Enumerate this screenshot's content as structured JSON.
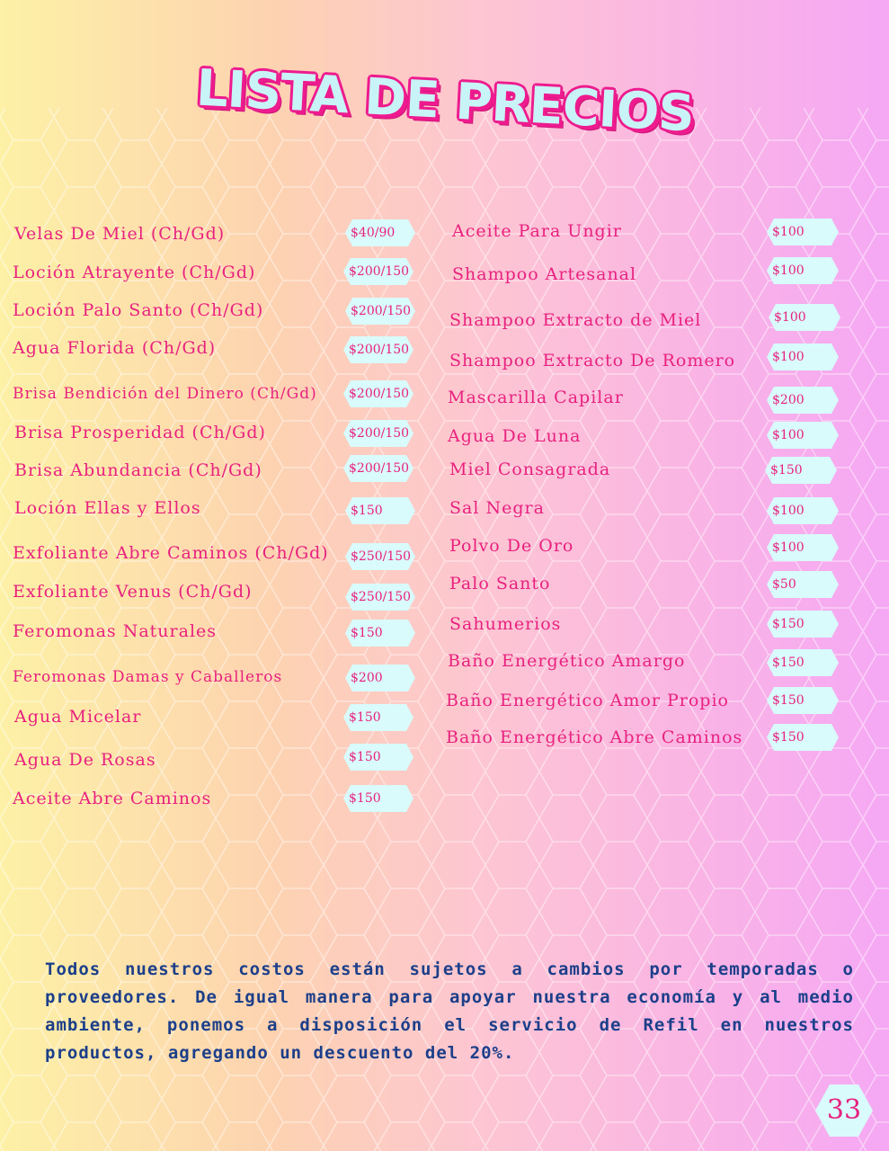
{
  "title": "LISTA DE PRECIOS",
  "left_items": [
    {
      "name": "Velas De Miel (Ch/Gd)",
      "price": "$40/90"
    },
    {
      "name": "Loción Atrayente (Ch/Gd)",
      "price": "$200/150"
    },
    {
      "name": "Loción Palo Santo (Ch/Gd)",
      "price": "$200/150"
    },
    {
      "name": "Agua Florida (Ch/Gd)",
      "price": "$200/150"
    },
    {
      "name": "Brisa Bendición del Dinero (Ch/Gd)",
      "price": "$200/150"
    },
    {
      "name": "Brisa Prosperidad (Ch/Gd)",
      "price": "$200/150"
    },
    {
      "name": "Brisa Abundancia (Ch/Gd)",
      "price": "$200/150"
    },
    {
      "name": "Loción Ellas y Ellos",
      "price": "$150"
    },
    {
      "name": "Exfoliante Abre Caminos (Ch/Gd)",
      "price": "$250/150"
    },
    {
      "name": "Exfoliante Venus (Ch/Gd)",
      "price": "$250/150"
    },
    {
      "name": "Feromonas Naturales",
      "price": "$150"
    },
    {
      "name": "Feromonas Damas y Caballeros",
      "price": "$200"
    },
    {
      "name": "Agua Micelar",
      "price": "$150"
    },
    {
      "name": "Agua De Rosas",
      "price": "$150"
    },
    {
      "name": "Aceite Abre Caminos",
      "price": "$150"
    }
  ],
  "right_items": [
    {
      "name": "Aceite Para Ungir",
      "price": "$100"
    },
    {
      "name": "Shampoo Artesanal",
      "price": "$100"
    },
    {
      "name": "Shampoo Extracto de Miel",
      "price": "$100"
    },
    {
      "name": "Shampoo Extracto De Romero",
      "price": "$100"
    },
    {
      "name": "Mascarilla Capilar",
      "price": "$200"
    },
    {
      "name": "Agua De Luna",
      "price": "$100"
    },
    {
      "name": "Miel Consagrada",
      "price": "$150"
    },
    {
      "name": "Sal Negra",
      "price": "$100"
    },
    {
      "name": "Polvo De Oro",
      "price": "$100"
    },
    {
      "name": "Palo Santo",
      "price": "$50"
    },
    {
      "name": "Sahumerios",
      "price": "$150"
    },
    {
      "name": "Baño Energético Amargo",
      "price": "$150"
    },
    {
      "name": "Baño Energético Amor Propio",
      "price": "$150"
    },
    {
      "name": "Baño Energético Abre Caminos",
      "price": "$150"
    }
  ],
  "note": "Todos nuestros costos están sujetos a cambios por temporadas o proveedores. De igual manera para apoyar nuestra economía y al medio ambiente, ponemos a disposición el servicio de Refil en nuestros productos, agregando un descuento del 20%.",
  "page_number": "33",
  "colors": {
    "accent": "#e8217f",
    "price_bg": "#d9fbfb",
    "note_text": "#1c3f8a"
  }
}
